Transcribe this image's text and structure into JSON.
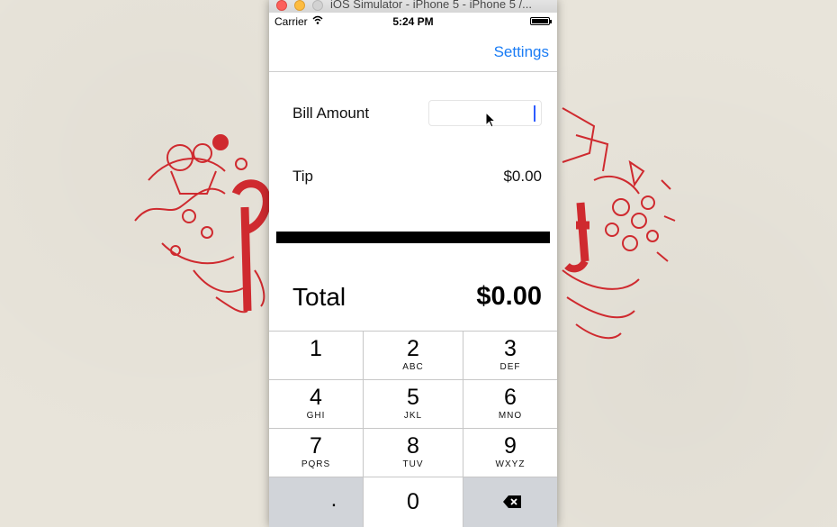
{
  "window": {
    "title": "iOS Simulator - iPhone 5 - iPhone 5 /..."
  },
  "status_bar": {
    "carrier": "Carrier",
    "time": "5:24 PM"
  },
  "nav": {
    "settings_label": "Settings"
  },
  "form": {
    "bill_amount_label": "Bill Amount",
    "bill_amount_value": "",
    "tip_label": "Tip",
    "tip_value": "$0.00",
    "total_label": "Total",
    "total_value": "$0.00"
  },
  "keypad": {
    "keys": [
      {
        "num": "1",
        "letters": ""
      },
      {
        "num": "2",
        "letters": "ABC"
      },
      {
        "num": "3",
        "letters": "DEF"
      },
      {
        "num": "4",
        "letters": "GHI"
      },
      {
        "num": "5",
        "letters": "JKL"
      },
      {
        "num": "6",
        "letters": "MNO"
      },
      {
        "num": "7",
        "letters": "PQRS"
      },
      {
        "num": "8",
        "letters": "TUV"
      },
      {
        "num": "9",
        "letters": "WXYZ"
      }
    ],
    "decimal": ".",
    "zero": "0"
  },
  "colors": {
    "accent": "#1a7cf5",
    "wallpaper_art": "#cf2a2f",
    "caret": "#2d5bff"
  }
}
